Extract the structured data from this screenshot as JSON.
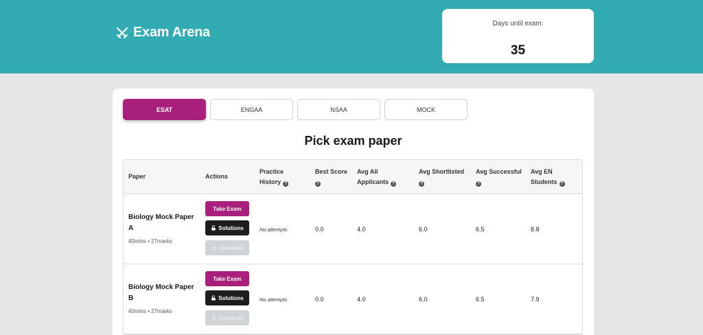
{
  "header": {
    "logo_text": "Exam Arena",
    "days_label": "Days until exam:",
    "days_value": "35"
  },
  "tabs": [
    {
      "label": "ESAT",
      "active": true
    },
    {
      "label": "ENGAA",
      "active": false
    },
    {
      "label": "NSAA",
      "active": false
    },
    {
      "label": "MOCK",
      "active": false
    }
  ],
  "page_title": "Pick exam paper",
  "table": {
    "headers": {
      "paper": "Paper",
      "actions": "Actions",
      "practice_1": "Practice",
      "practice_2": "History",
      "best_score": "Best Score",
      "avg_all_1": "Avg All",
      "avg_all_2": "Applicants",
      "avg_shortlisted": "Avg Shortlisted",
      "avg_successful": "Avg Successful",
      "avg_en_1": "Avg EN",
      "avg_en_2": "Students"
    },
    "buttons": {
      "take": "Take Exam",
      "solutions": "Solutions",
      "download": "Download"
    },
    "rows": [
      {
        "name": "Biology Mock Paper A",
        "meta": "40mins • 27marks",
        "practice": "No attempts",
        "best": "0.0",
        "avg_all": "4.0",
        "avg_short": "6.0",
        "avg_succ": "6.5",
        "avg_en": "8.8"
      },
      {
        "name": "Biology Mock Paper B",
        "meta": "40mins • 27marks",
        "practice": "No attempts",
        "best": "0.0",
        "avg_all": "4.0",
        "avg_short": "6.0",
        "avg_succ": "6.5",
        "avg_en": "7.9"
      }
    ]
  },
  "colors": {
    "header_bg": "#32abb2",
    "accent": "#a8207b",
    "dark_button": "#1e1e1e",
    "disabled_button": "#cfd3d6"
  },
  "icons": {
    "logo": "crossed-swords-icon",
    "help": "question-circle-icon",
    "solutions": "unlock-icon",
    "download": "download-icon"
  }
}
